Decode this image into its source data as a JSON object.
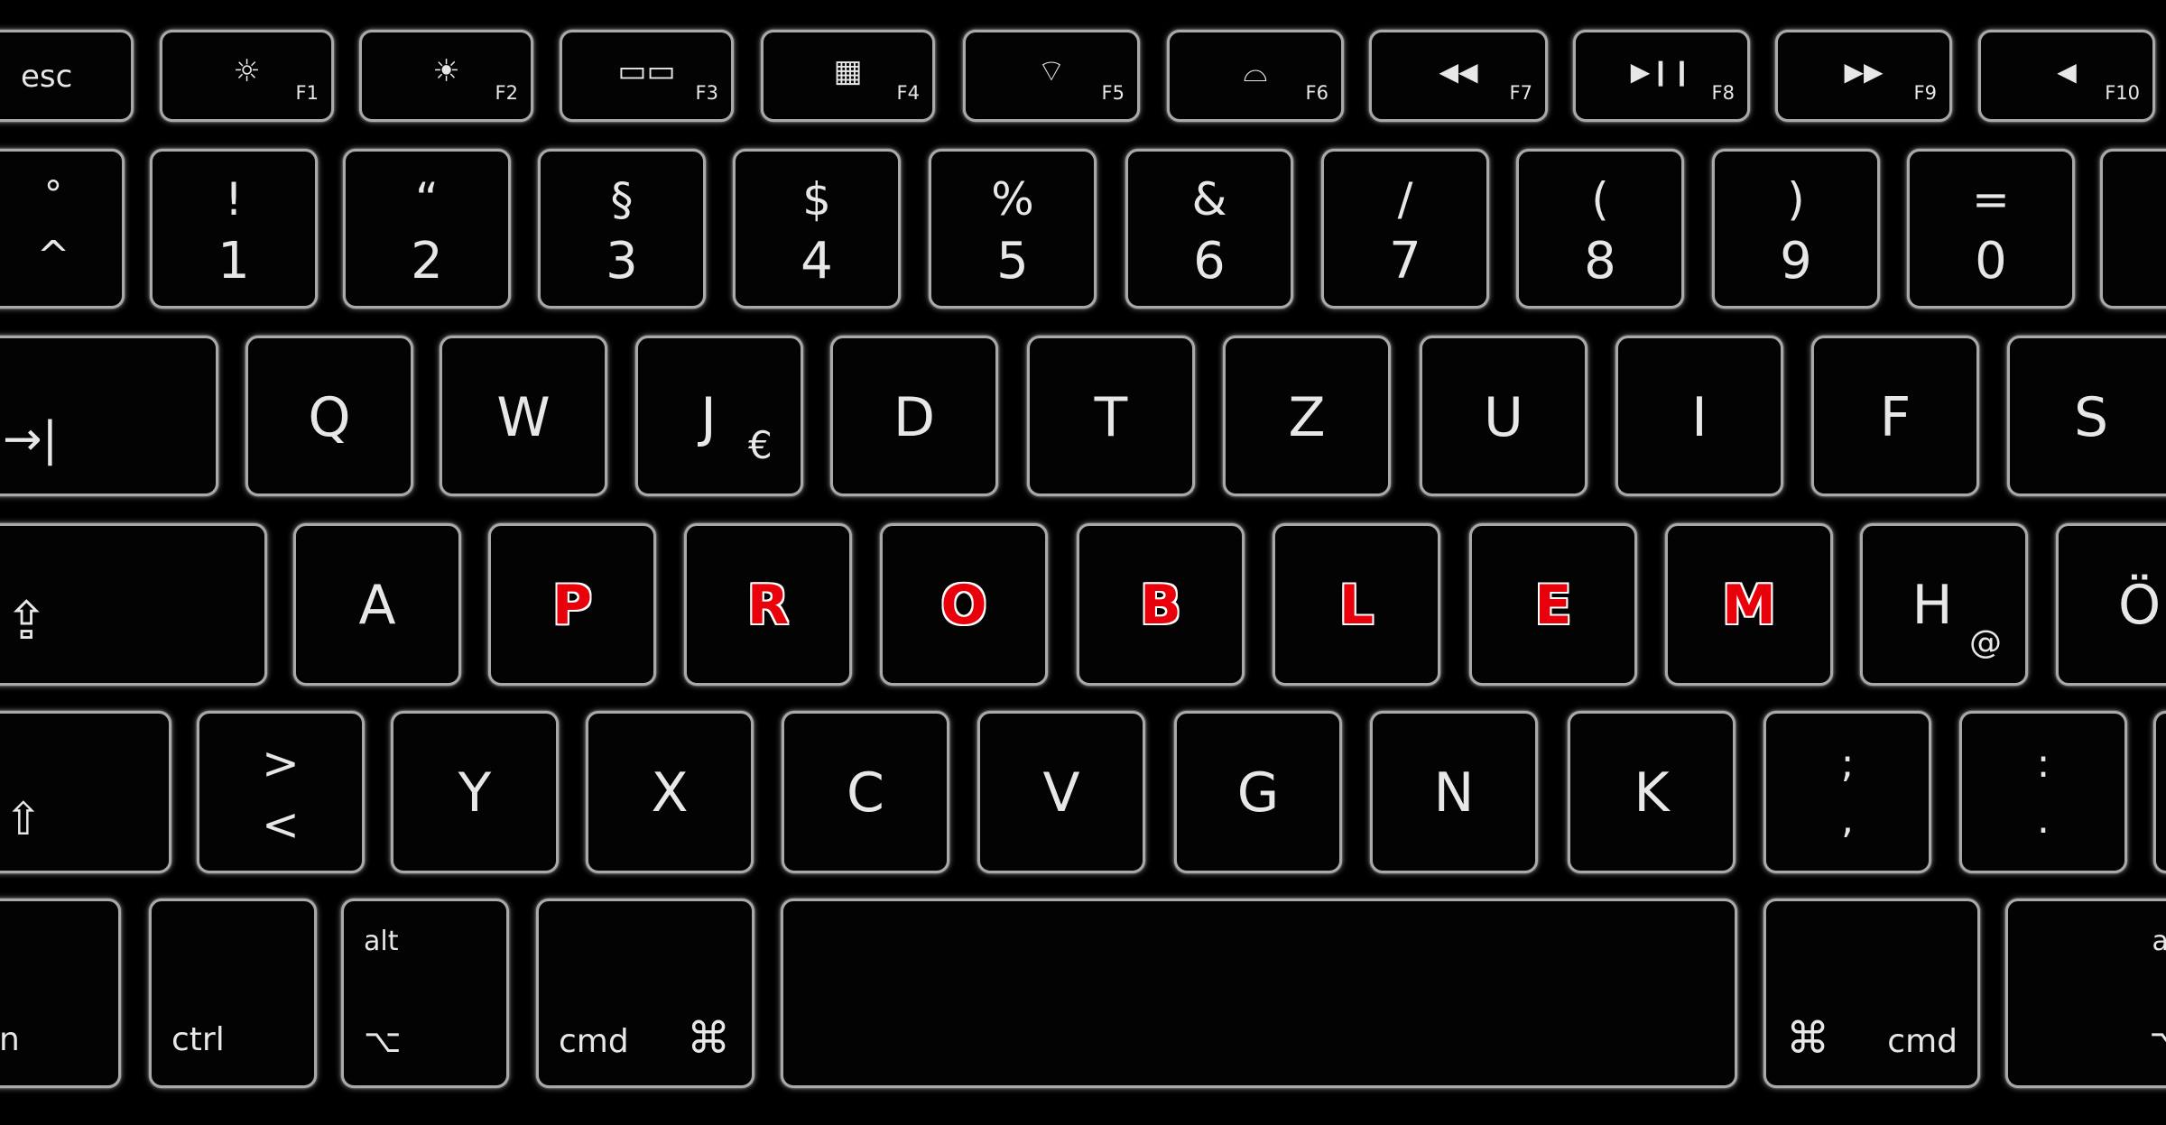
{
  "function_row": [
    {
      "label": "esc"
    },
    {
      "icon": "brightness-down-icon",
      "glyph": "☼",
      "label": "F1"
    },
    {
      "icon": "brightness-up-icon",
      "glyph": "☀",
      "label": "F2"
    },
    {
      "icon": "mission-control-icon",
      "glyph": "▭▭",
      "label": "F3"
    },
    {
      "icon": "launchpad-icon",
      "glyph": "▦",
      "label": "F4"
    },
    {
      "icon": "keyboard-light-down-icon",
      "glyph": "⌔",
      "label": "F5"
    },
    {
      "icon": "keyboard-light-up-icon",
      "glyph": "⌓",
      "label": "F6"
    },
    {
      "icon": "rewind-icon",
      "glyph": "◀◀",
      "label": "F7"
    },
    {
      "icon": "play-pause-icon",
      "glyph": "▶❙❙",
      "label": "F8"
    },
    {
      "icon": "fast-forward-icon",
      "glyph": "▶▶",
      "label": "F9"
    },
    {
      "icon": "mute-icon",
      "glyph": "◀",
      "label": "F10"
    }
  ],
  "number_row": [
    {
      "top": "°",
      "bottom": "^"
    },
    {
      "top": "!",
      "bottom": "1"
    },
    {
      "top": "“",
      "bottom": "2"
    },
    {
      "top": "§",
      "bottom": "3"
    },
    {
      "top": "$",
      "bottom": "4"
    },
    {
      "top": "%",
      "bottom": "5"
    },
    {
      "top": "&",
      "bottom": "6"
    },
    {
      "top": "/",
      "bottom": "7"
    },
    {
      "top": "(",
      "bottom": "8"
    },
    {
      "top": ")",
      "bottom": "9"
    },
    {
      "top": "=",
      "bottom": "0"
    }
  ],
  "row1": {
    "tab": {
      "icon": "tab-icon",
      "glyph": "→|"
    },
    "letters": [
      "Q",
      "W",
      "J",
      "D",
      "T",
      "Z",
      "U",
      "I",
      "F",
      "S"
    ],
    "j_sub": "€"
  },
  "row2": {
    "caps": {
      "icon": "caps-lock-icon",
      "glyph": "⇪"
    },
    "letters": [
      "A",
      "P",
      "R",
      "O",
      "B",
      "L",
      "E",
      "M",
      "H",
      "Ö"
    ],
    "highlight_color": "#e8000a",
    "h_sub": "@"
  },
  "row3": {
    "shift": {
      "icon": "shift-icon",
      "glyph": "⇧"
    },
    "angle": {
      "top": ">",
      "bottom": "<"
    },
    "letters": [
      "Y",
      "X",
      "C",
      "V",
      "G",
      "N",
      "K"
    ],
    "semicolon": {
      "top": ";",
      "bottom": ","
    },
    "colon": {
      "top": ":",
      "bottom": "."
    }
  },
  "row4": {
    "fn_fragment": "n",
    "ctrl": "ctrl",
    "alt": "alt",
    "option_glyph": "⌥",
    "cmd": "cmd",
    "cmd_glyph": "⌘"
  }
}
